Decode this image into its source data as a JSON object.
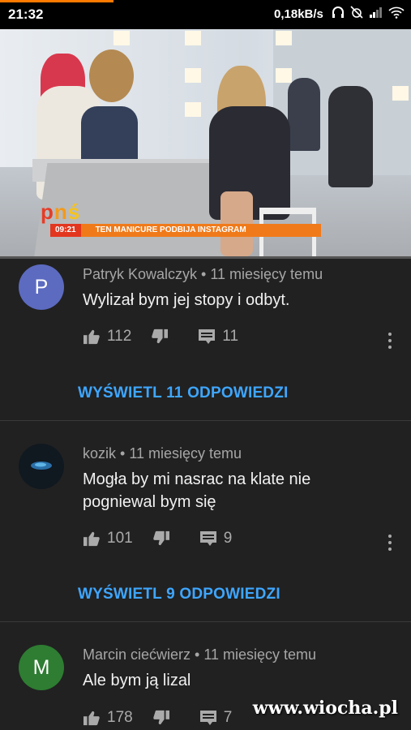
{
  "status_bar": {
    "time": "21:32",
    "network_speed": "0,18kB/s",
    "icons": [
      "headphones-icon",
      "alarm-off-icon",
      "signal-icon",
      "wifi-icon"
    ]
  },
  "video": {
    "logo_letters": [
      "p",
      "n",
      "ś"
    ],
    "ticker_time": "09:21",
    "ticker_text": "TEN MANICURE PODBIJA INSTAGRAM",
    "progress_fraction": 0.0
  },
  "comments": [
    {
      "avatar_letter": "P",
      "avatar_color": "#5c6bc0",
      "author": "Patryk Kowalczyk",
      "time": "11 miesięcy temu",
      "text": "Wylizał bym jej stopy i odbyt.",
      "likes": "112",
      "replies": "11",
      "view_replies_label": "WYŚWIETL 11 ODPOWIEDZI"
    },
    {
      "avatar_letter": "",
      "avatar_color": "#101820",
      "author": "kozik",
      "time": "11 miesięcy temu",
      "text": "Mogła by mi nasrac na klate nie pogniewal bym się",
      "likes": "101",
      "replies": "9",
      "view_replies_label": "WYŚWIETL 9 ODPOWIEDZI"
    },
    {
      "avatar_letter": "M",
      "avatar_color": "#2e7d32",
      "author": "Marcin ciećwierz",
      "time": "11 miesięcy temu",
      "text": "Ale bym ją lizal",
      "likes": "178",
      "replies": "7",
      "view_replies_label": ""
    }
  ],
  "separator": " • ",
  "watermark": "www.wiocha.pl",
  "colors": {
    "background": "#212121",
    "link_blue": "#3ea6ff",
    "accent_orange": "#f07a1a"
  }
}
